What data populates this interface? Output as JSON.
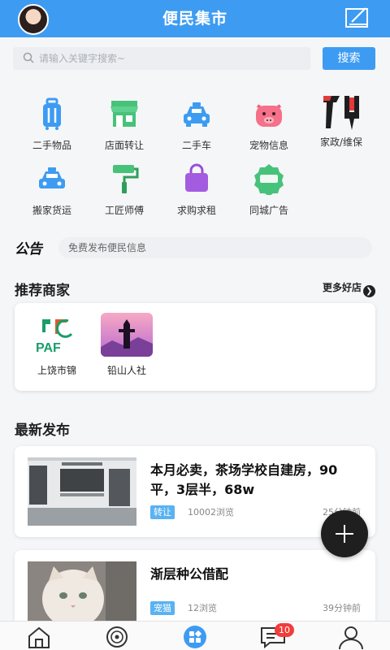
{
  "header": {
    "title": "便民集市"
  },
  "search": {
    "placeholder": "请输入关键字搜索~",
    "button_label": "搜索"
  },
  "categories": [
    {
      "label": "二手物品",
      "icon": "luggage-icon"
    },
    {
      "label": "店面转让",
      "icon": "storefront-icon"
    },
    {
      "label": "二手车",
      "icon": "car-icon"
    },
    {
      "label": "宠物信息",
      "icon": "pig-icon"
    },
    {
      "label": "家政/维保",
      "icon": "tools-icon"
    },
    {
      "label": "搬家货运",
      "icon": "taxi-icon"
    },
    {
      "label": "工匠师傅",
      "icon": "paint-roller-icon"
    },
    {
      "label": "求购求租",
      "icon": "shopping-bag-icon"
    },
    {
      "label": "同城广告",
      "icon": "ad-tag-icon"
    }
  ],
  "notice": {
    "logo_text": "公告",
    "text": "免费发布便民信息"
  },
  "merchants_section": {
    "title": "推荐商家",
    "more_label": "更多好店",
    "items": [
      {
        "name": "上饶市锦"
      },
      {
        "name": "铅山人社"
      }
    ]
  },
  "posts_section": {
    "title": "最新发布",
    "items": [
      {
        "title": "本月必卖，茶场学校自建房，90平，3层半，68w",
        "tag": "转让",
        "views": "10002浏览",
        "time": "25分钟前"
      },
      {
        "title": "渐层种公借配",
        "tag": "宠猫",
        "views": "12浏览",
        "time": "39分钟前"
      }
    ]
  },
  "tabbar": {
    "message_badge": "10"
  },
  "colors": {
    "primary": "#3d9cf2",
    "tag": "#5ab2f0",
    "badge": "#f23c3c"
  }
}
